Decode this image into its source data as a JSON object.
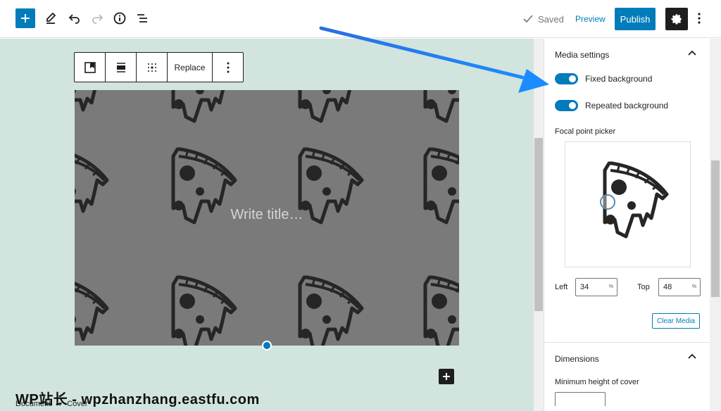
{
  "topbar": {
    "saved_label": "Saved",
    "preview_label": "Preview",
    "publish_label": "Publish",
    "accent": "#007cba"
  },
  "block_toolbar": {
    "replace_label": "Replace"
  },
  "cover": {
    "title_placeholder": "Write title…",
    "overlay_color": "#7a7a7a"
  },
  "canvas": {
    "background": "#d1e4dd"
  },
  "watermark": "WP站长 - wpzhanzhang.eastfu.com",
  "breadcrumb": {
    "items": [
      "Document",
      "Cover"
    ],
    "separator": "→"
  },
  "sidebar": {
    "media_settings": {
      "title": "Media settings",
      "fixed_background": {
        "label": "Fixed background",
        "enabled": true
      },
      "repeated_background": {
        "label": "Repeated background",
        "enabled": true
      },
      "focal_label": "Focal point picker",
      "left_label": "Left",
      "left_value": "34",
      "top_label": "Top",
      "top_value": "48",
      "unit": "%",
      "clear_media_label": "Clear Media"
    },
    "dimensions": {
      "title": "Dimensions",
      "min_height_label": "Minimum height of cover"
    }
  }
}
